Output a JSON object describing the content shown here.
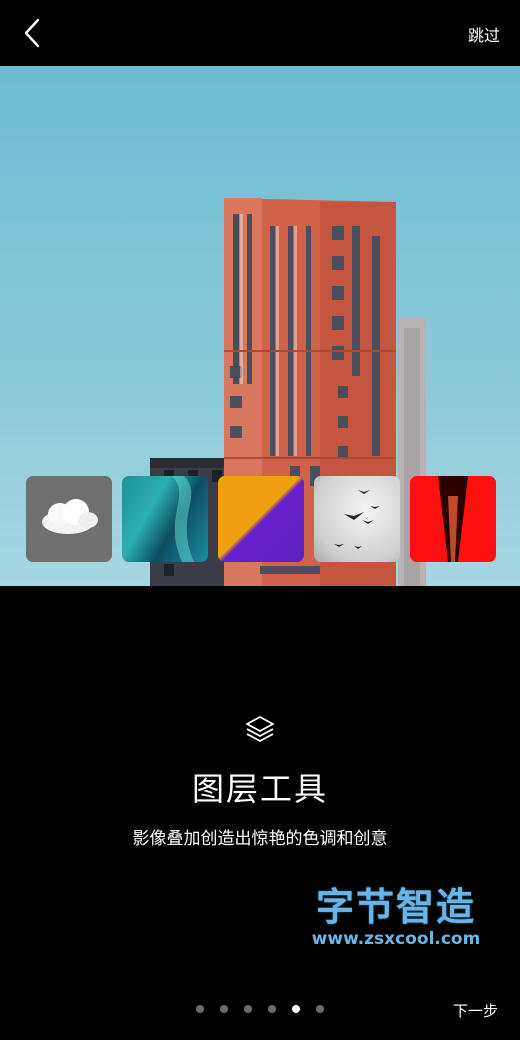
{
  "topbar": {
    "skip_label": "跳过"
  },
  "feature": {
    "title": "图层工具",
    "subtitle": "影像叠加创造出惊艳的色调和创意"
  },
  "watermark": {
    "brand": "字节智造",
    "url": "www.zsxcool.com"
  },
  "thumbnails": [
    {
      "name": "cloud"
    },
    {
      "name": "aurora"
    },
    {
      "name": "gradient"
    },
    {
      "name": "birds"
    },
    {
      "name": "red-tunnel"
    }
  ],
  "pagination": {
    "total": 6,
    "active_index": 4
  },
  "footer": {
    "next_label": "下一步"
  },
  "colors": {
    "background": "#000000",
    "accent": "#6bb5e6",
    "sky": "#7cc2d6",
    "building": "#d0624a"
  }
}
